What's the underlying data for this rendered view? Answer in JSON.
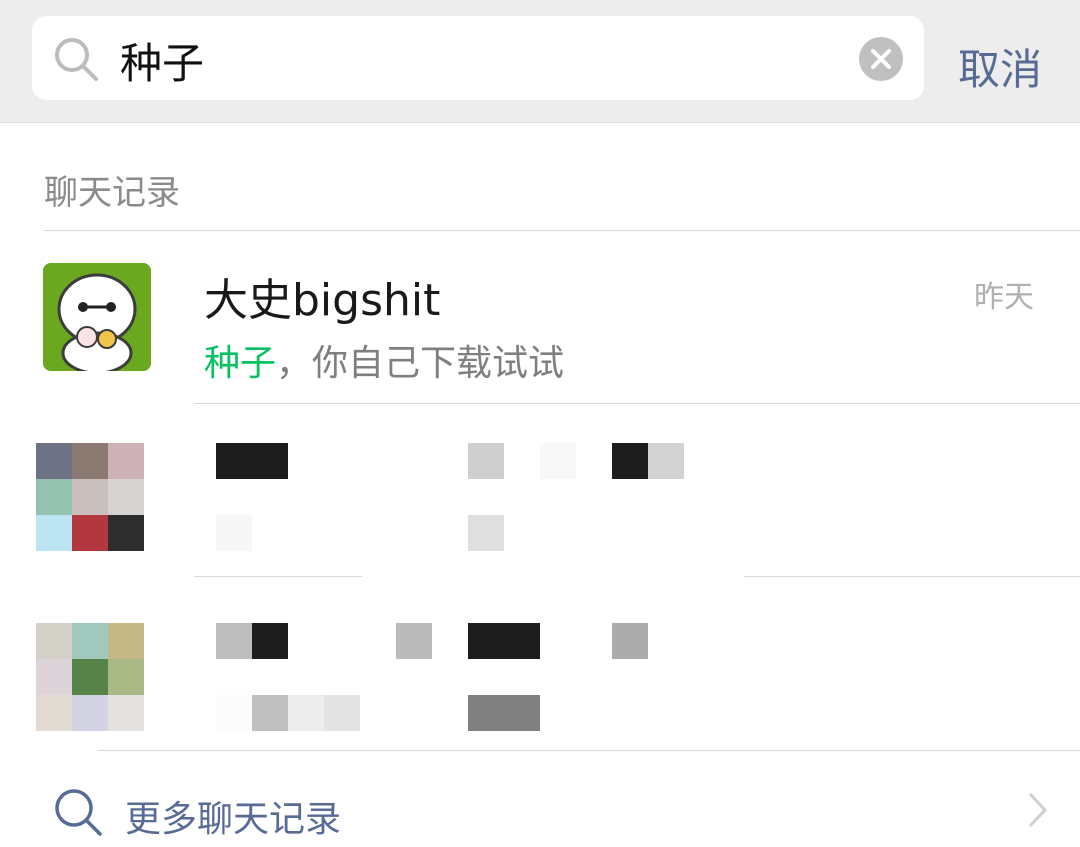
{
  "search": {
    "value": "种子",
    "cancel_label": "取消"
  },
  "results": {
    "section_title": "聊天记录",
    "item": {
      "name": "大史bigshit",
      "time": "昨天",
      "snippet_highlight": "种子",
      "snippet_rest": "，你自己下载试试"
    },
    "more_label": "更多聊天记录"
  },
  "colors": {
    "accent_link": "#576b95",
    "highlight_green": "#07c160",
    "topbar_bg": "#ededed"
  },
  "icons": {
    "search": "search-icon",
    "clear": "clear-icon",
    "chevron": "chevron-right-icon"
  }
}
